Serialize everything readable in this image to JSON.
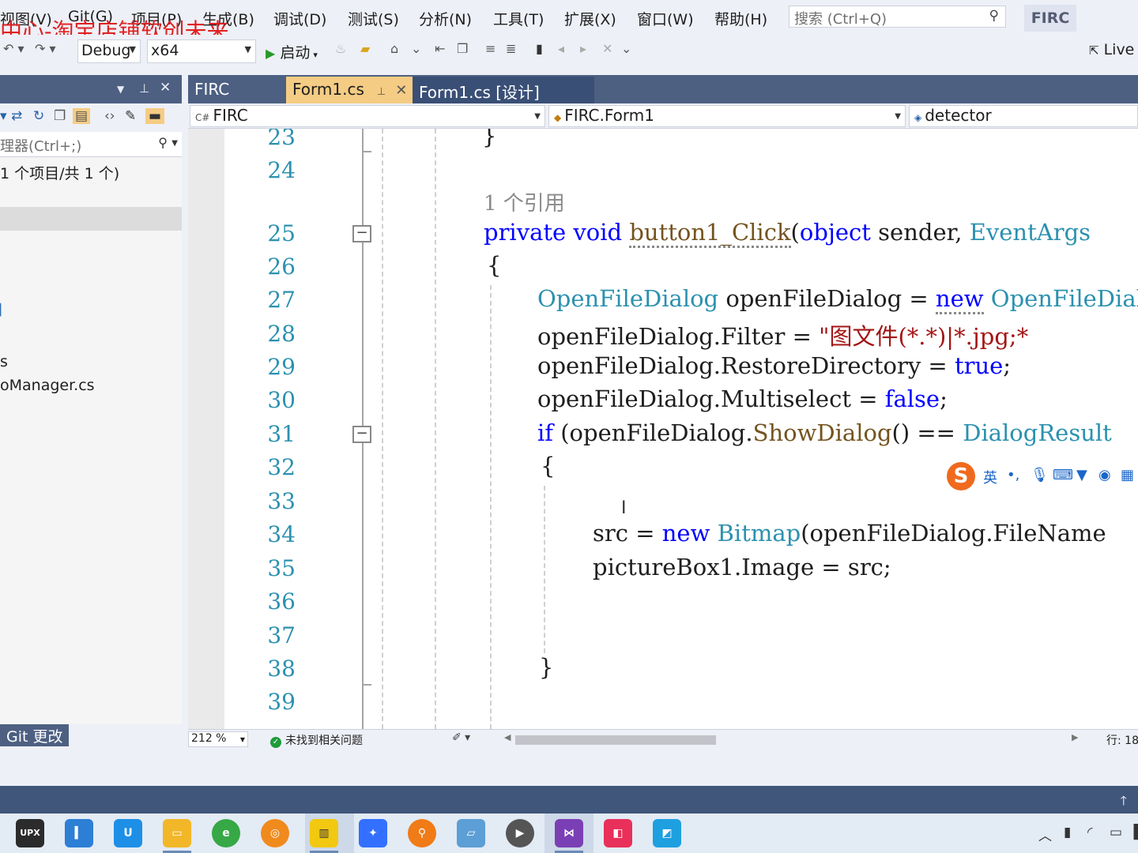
{
  "menubar": {
    "items": [
      {
        "label": "视图(V)"
      },
      {
        "label": "Git(G)"
      },
      {
        "label": "项目(P)"
      },
      {
        "label": "生成(B)"
      },
      {
        "label": "调试(D)"
      },
      {
        "label": "测试(S)"
      },
      {
        "label": "分析(N)"
      },
      {
        "label": "工具(T)"
      },
      {
        "label": "扩展(X)"
      },
      {
        "label": "窗口(W)"
      },
      {
        "label": "帮助(H)"
      }
    ],
    "search_placeholder": "搜索 (Ctrl+Q)",
    "solution_badge": "FIRC"
  },
  "watermark": "中心-淘宝店铺软创未来",
  "toolbar": {
    "config": "Debug",
    "platform": "x64",
    "start_label": "启动",
    "live_share": "Live"
  },
  "solution_explorer": {
    "search_placeholder": "理器(Ctrl+;)",
    "count_text": "1 个项目/共 1 个)",
    "nodes": [
      "s",
      "oManager.cs"
    ]
  },
  "git_tab": "Git 更改",
  "doc_tabs": [
    {
      "label": "FIRC",
      "state": "inactive"
    },
    {
      "label": "Form1.cs",
      "state": "active"
    },
    {
      "label": "Form1.cs [设计]",
      "state": "design"
    }
  ],
  "nav": {
    "project": "FIRC",
    "class": "FIRC.Form1",
    "member": "detector"
  },
  "code": {
    "line_numbers": [
      "23",
      "24",
      "25",
      "26",
      "27",
      "28",
      "29",
      "30",
      "31",
      "32",
      "33",
      "34",
      "35",
      "36",
      "37",
      "38",
      "39"
    ],
    "ref_hint": "1 个引用",
    "lines": {
      "l23": "}",
      "l25_kw1": "private",
      "l25_kw2": "void",
      "l25_method": "button1_Click",
      "l25_paren": "(",
      "l25_kw3": "object",
      "l25_rest": " sender, ",
      "l25_type": "EventArgs",
      "l26": "{",
      "l27_type1": "OpenFileDialog",
      "l27_mid": " openFileDialog = ",
      "l27_kw": "new",
      "l27_type2": " OpenFileDialog",
      "l28_pre": "openFileDialog.Filter = ",
      "l28_str": "\"图文件(*.*)|*.jpg;*",
      "l29_pre": "openFileDialog.RestoreDirectory = ",
      "l29_kw": "true",
      "l29_end": ";",
      "l30_pre": "openFileDialog.Multiselect = ",
      "l30_kw": "false",
      "l30_end": ";",
      "l31_kw": "if",
      "l31_pre": " (openFileDialog.",
      "l31_method": "ShowDialog",
      "l31_mid": "() == ",
      "l31_type": "DialogResult",
      "l32": "{",
      "l34_pre": "src = ",
      "l34_kw": "new",
      "l34_type": " Bitmap",
      "l34_rest": "(openFileDialog.FileName",
      "l35": "pictureBox1.Image = src;",
      "l38": "}"
    }
  },
  "ime": {
    "logo": "S",
    "mode": "英",
    "punct": "•,",
    "voice_icon": "mic-icon",
    "keyboard_icon": "keyboard-icon",
    "skin_icon": "shirt-icon",
    "game_icon": "gamepad-icon",
    "tools_icon": "grid-icon"
  },
  "status": {
    "zoom": "212 %",
    "issues": "未找到相关问题",
    "line_col": "行: 18"
  },
  "taskbar": {
    "apps": [
      {
        "name": "upx",
        "label": "UPX",
        "color": "#2b2b2b"
      },
      {
        "name": "notebook",
        "label": "",
        "color": "#2d7fd6"
      },
      {
        "name": "uu-booster",
        "label": "U",
        "color": "#1e8fe6"
      },
      {
        "name": "file-explorer",
        "label": "",
        "color": "#f2b728"
      },
      {
        "name": "360-browser",
        "label": "e",
        "color": "#36a845"
      },
      {
        "name": "audio-tool",
        "label": "",
        "color": "#f08a1d"
      },
      {
        "name": "power-bi",
        "label": "",
        "color": "#f2c811"
      },
      {
        "name": "feishu",
        "label": "",
        "color": "#3370ff"
      },
      {
        "name": "search-tool",
        "label": "",
        "color": "#f07b17"
      },
      {
        "name": "notes",
        "label": "",
        "color": "#5c9fd6"
      },
      {
        "name": "media-player",
        "label": "",
        "color": "#555555"
      },
      {
        "name": "visual-studio",
        "label": "",
        "color": "#7b3fb5"
      },
      {
        "name": "dingtalk-red",
        "label": "",
        "color": "#e8305a"
      },
      {
        "name": "office-tool",
        "label": "",
        "color": "#1ea0e0"
      }
    ]
  }
}
